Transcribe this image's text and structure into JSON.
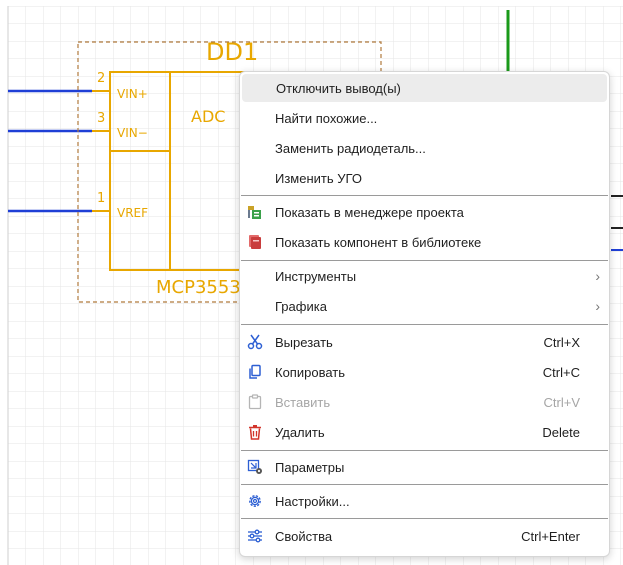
{
  "schematic": {
    "refdes": "DD1",
    "part_name": "MCP3553",
    "block_label": "ADC",
    "pins": [
      {
        "number": "2",
        "name": "VIN+"
      },
      {
        "number": "3",
        "name": "VIN−"
      },
      {
        "number": "1",
        "name": "VREF"
      }
    ]
  },
  "context_menu": {
    "items": [
      {
        "label": "Отключить вывод(ы)",
        "icon": "",
        "shortcut": "",
        "submenu": false
      },
      {
        "label": "Найти похожие...",
        "icon": "",
        "shortcut": "",
        "submenu": false
      },
      {
        "label": "Заменить радиодеталь...",
        "icon": "",
        "shortcut": "",
        "submenu": false
      },
      {
        "label": "Изменить УГО",
        "icon": "",
        "shortcut": "",
        "submenu": false
      },
      {
        "label": "Показать в менеджере проекта",
        "icon": "project-manager-icon",
        "shortcut": "",
        "submenu": false
      },
      {
        "label": "Показать компонент в библиотеке",
        "icon": "library-icon",
        "shortcut": "",
        "submenu": false
      },
      {
        "label": "Инструменты",
        "icon": "",
        "shortcut": "",
        "submenu": true
      },
      {
        "label": "Графика",
        "icon": "",
        "shortcut": "",
        "submenu": true
      },
      {
        "label": "Вырезать",
        "icon": "scissors-icon",
        "shortcut": "Ctrl+X",
        "submenu": false
      },
      {
        "label": "Копировать",
        "icon": "copy-icon",
        "shortcut": "Ctrl+C",
        "submenu": false
      },
      {
        "label": "Вставить",
        "icon": "paste-icon",
        "shortcut": "Ctrl+V",
        "submenu": false,
        "disabled": true
      },
      {
        "label": "Удалить",
        "icon": "trash-icon",
        "shortcut": "Delete",
        "submenu": false
      },
      {
        "label": "Параметры",
        "icon": "parameters-icon",
        "shortcut": "",
        "submenu": false
      },
      {
        "label": "Настройки...",
        "icon": "gear-icon",
        "shortcut": "",
        "submenu": false
      },
      {
        "label": "Свойства",
        "icon": "sliders-icon",
        "shortcut": "Ctrl+Enter",
        "submenu": false
      }
    ]
  },
  "colors": {
    "component": "#e8a700",
    "wire": "#1f3fd6",
    "green_wire": "#1a9a1a",
    "grid": "#e6e6e6",
    "delete_icon": "#d2352b"
  }
}
